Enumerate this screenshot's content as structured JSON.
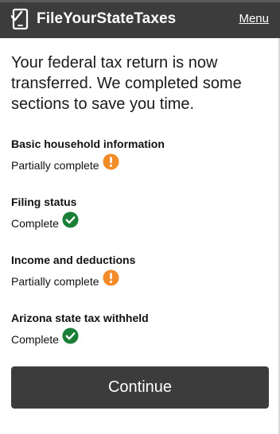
{
  "header": {
    "brand": "FileYourStateTaxes",
    "menu_label": "Menu",
    "logo_icon": "phone-check-icon",
    "background": "#3c3c3c"
  },
  "main": {
    "headline": "Your federal tax return is now transferred. We completed some sections to save you time.",
    "sections": [
      {
        "title": "Basic household information",
        "status": "Partially complete",
        "status_icon": "alert-icon"
      },
      {
        "title": "Filing status",
        "status": "Complete",
        "status_icon": "check-icon"
      },
      {
        "title": "Income and deductions",
        "status": "Partially complete",
        "status_icon": "alert-icon"
      },
      {
        "title": "Arizona state tax withheld",
        "status": "Complete",
        "status_icon": "check-icon"
      }
    ],
    "continue_label": "Continue"
  },
  "colors": {
    "warning": "#f28c28",
    "success": "#1a7f37",
    "button": "#3c3c3c"
  }
}
